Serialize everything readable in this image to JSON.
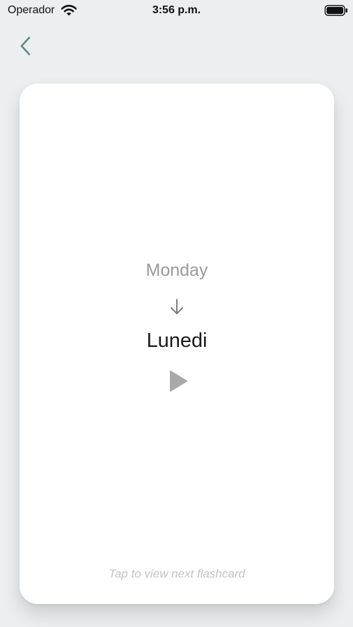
{
  "status_bar": {
    "carrier": "Operador",
    "time": "3:56 p.m.",
    "icons": [
      "wifi-icon",
      "battery-icon"
    ]
  },
  "nav": {
    "back_icon": "chevron-left-icon"
  },
  "flashcard": {
    "source_word": "Monday",
    "target_word": "Lunedi",
    "arrow_icon": "arrow-down-icon",
    "play_icon": "play-icon",
    "hint": "Tap to view next flashcard"
  },
  "colors": {
    "background": "#eceef0",
    "card": "#ffffff",
    "accent": "#5f8a8b",
    "source_text": "#9a9a9a",
    "target_text": "#1a1a1a",
    "hint_text": "#c3c3c3",
    "play_icon": "#a9a9a9"
  }
}
